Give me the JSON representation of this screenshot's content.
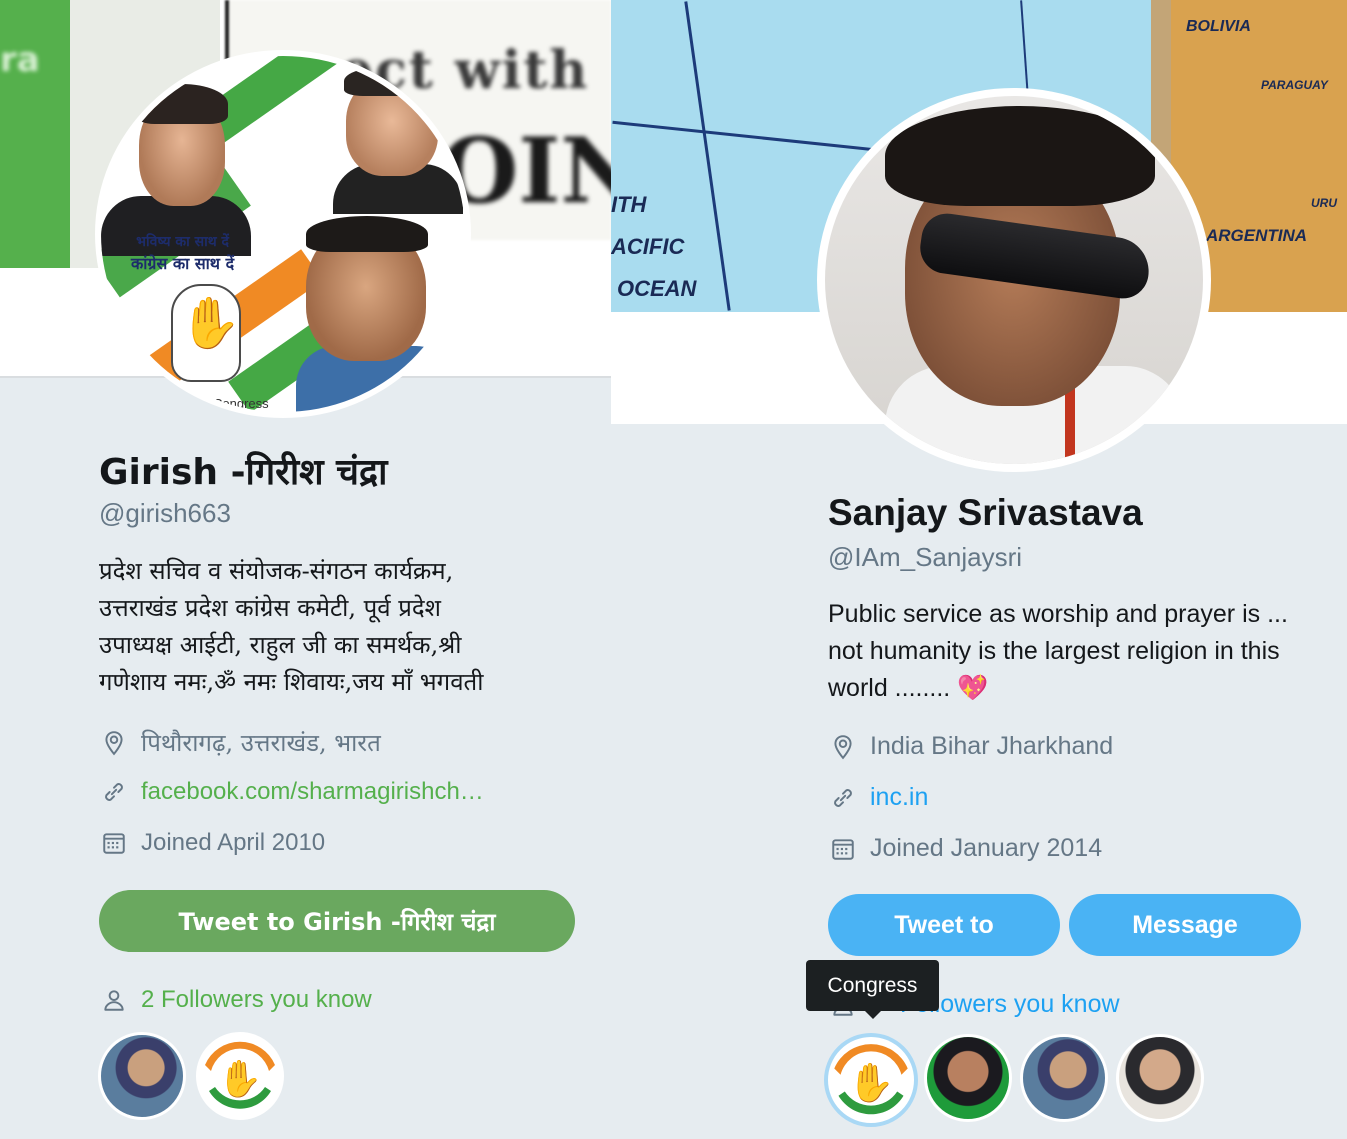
{
  "left_profile": {
    "banner": {
      "text_fragment": "ect with",
      "text_fragment2": "OIN",
      "left_fragment": "ra"
    },
    "avatar": {
      "poster_line1": "भविष्य का साथ दें",
      "poster_line2": "कांग्रेस का साथ दें",
      "poster_label": "Congress"
    },
    "name": "Girish -गिरीश चंद्रा",
    "handle": "@girish663",
    "bio_lines": [
      "प्रदेश सचिव व संयोजक-संगठन कार्यक्रम,",
      "उत्तराखंड प्रदेश कांग्रेस कमेटी, पूर्व प्रदेश",
      "उपाध्यक्ष आईटी, राहुल जी का समर्थक,श्री",
      "गणेशाय नमः,ॐ नमः शिवायः,जय माँ भगवती"
    ],
    "location": "पिथौरागढ़, उत्तराखंड, भारत",
    "website": "facebook.com/sharmagirishch…",
    "joined": "Joined April 2010",
    "tweet_button": "Tweet to Girish -गिरीश चंद्रा",
    "followers_you_know": "2 Followers you know",
    "accent_color": "#55b04c",
    "button_color": "#6aa85f"
  },
  "right_profile": {
    "banner": {
      "labels": [
        "BOLIVIA",
        "PARAGUAY",
        "URU",
        "ARGENTINA",
        "ITH",
        "ACIFIC",
        "OCEAN"
      ]
    },
    "name": "Sanjay Srivastava",
    "handle": "@IAm_Sanjaysri",
    "bio_lines": [
      "Public service as worship and prayer is ...",
      "not humanity is the largest religion in this",
      "world ........ 💖"
    ],
    "location": "India Bihar Jharkhand",
    "website": "inc.in",
    "joined": "Joined January 2014",
    "tweet_button": "Tweet to",
    "message_button": "Message",
    "followers_you_know": "Followers you know",
    "tooltip": "Congress",
    "accent_color": "#1da1f2",
    "button_color": "#4ab3f4"
  },
  "icons": {
    "location": "location-pin-icon",
    "link": "link-icon",
    "calendar": "calendar-icon",
    "person": "person-icon"
  }
}
